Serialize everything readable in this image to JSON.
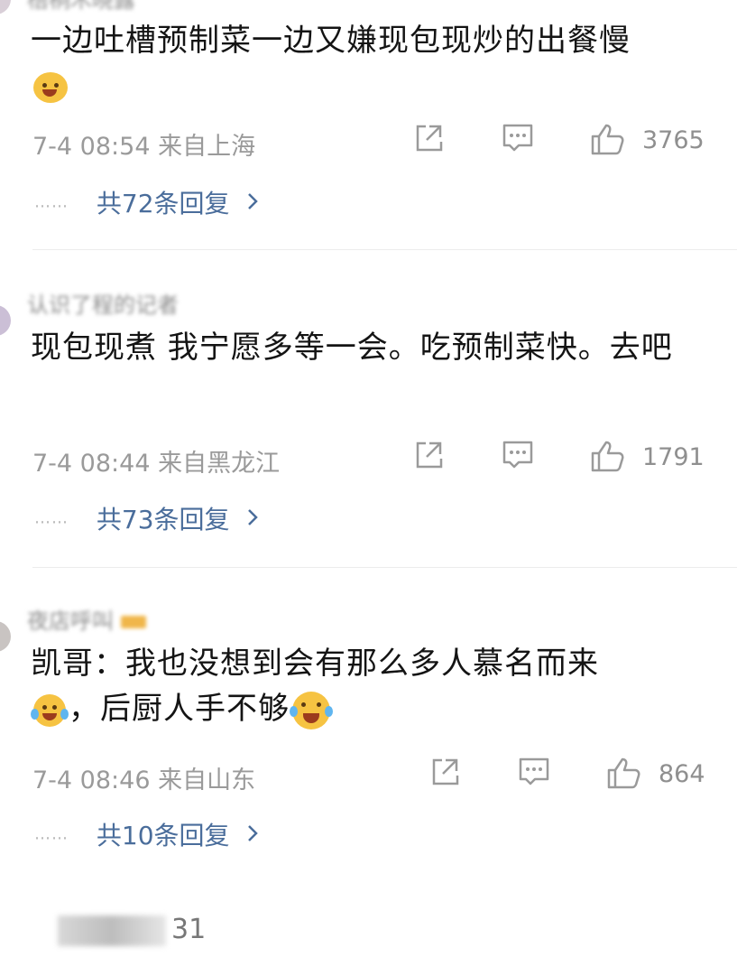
{
  "comments": [
    {
      "username": "梧桐木晓露",
      "text": "一边吐槽预制菜一边又嫌现包现炒的出餐慢",
      "time": "7-4 08:54 来自上海",
      "likes": "3765",
      "replies_label": "共72条回复",
      "dots": "……",
      "emoji_end": "shrug-emoji"
    },
    {
      "username": "认识了程的记者",
      "text": "现包现煮 我宁愿多等一会。吃预制菜快。去吧",
      "time": "7-4 08:44 来自黑龙江",
      "likes": "1791",
      "replies_label": "共73条回复",
      "dots": "……"
    },
    {
      "username": "夜店呼叫",
      "text_part1": "凯哥：我也没想到会有那么多人慕名而来",
      "text_part2": "，后厨人手不够",
      "time": "7-4 08:46 来自山东",
      "likes": "864",
      "replies_label": "共10条回复",
      "dots": "……",
      "emoji_inline": "laughing-crying-emoji",
      "emoji_end": "laughing-emoji"
    }
  ],
  "bottom_partial": "31",
  "icons": {
    "share": "share-icon",
    "comment": "comment-icon",
    "like": "thumbs-up-icon",
    "chevron": "chevron-right-icon"
  },
  "colors": {
    "reply_link": "#4a6d9b",
    "meta_gray": "#9a9a9a"
  }
}
